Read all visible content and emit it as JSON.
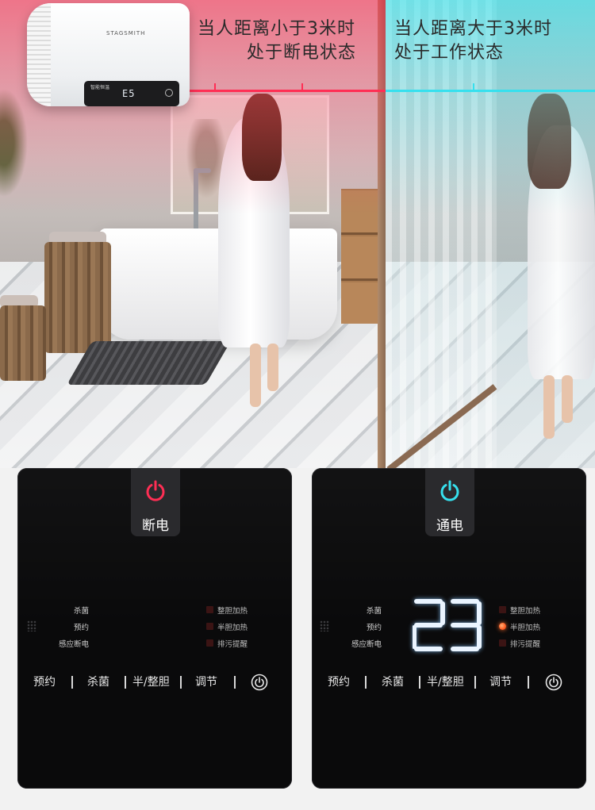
{
  "captions": {
    "left": [
      "当人距离小于3米时",
      "处于断电状态"
    ],
    "right": [
      "当人距离大于3米时",
      "处于工作状态"
    ]
  },
  "heater": {
    "brand": "STAGSMITH",
    "panel_label": "智能恒温",
    "display": "E5"
  },
  "colors": {
    "off_accent": "#ff2e54",
    "on_accent": "#36e0ee",
    "panel_bg": "#0a0a0b",
    "indicator_on": "#ff5a1f"
  },
  "panel_off": {
    "status_label": "断电",
    "status_icon": "power-icon-red",
    "left_labels": [
      "杀菌",
      "预约",
      "感应断电"
    ],
    "right_options": [
      "整胆加热",
      "半胆加热",
      "排污提醒"
    ],
    "buttons": [
      "预约",
      "杀菌",
      "半/整胆",
      "调节"
    ],
    "power_icon": "power-icon"
  },
  "panel_on": {
    "status_label": "通电",
    "status_icon": "power-icon-cyan",
    "left_labels": [
      "杀菌",
      "预约",
      "感应断电"
    ],
    "right_options": [
      "整胆加热",
      "半胆加热",
      "排污提醒"
    ],
    "active_option_index": 1,
    "temperature": "23",
    "buttons": [
      "预约",
      "杀菌",
      "半/整胆",
      "调节"
    ],
    "power_icon": "power-icon"
  }
}
